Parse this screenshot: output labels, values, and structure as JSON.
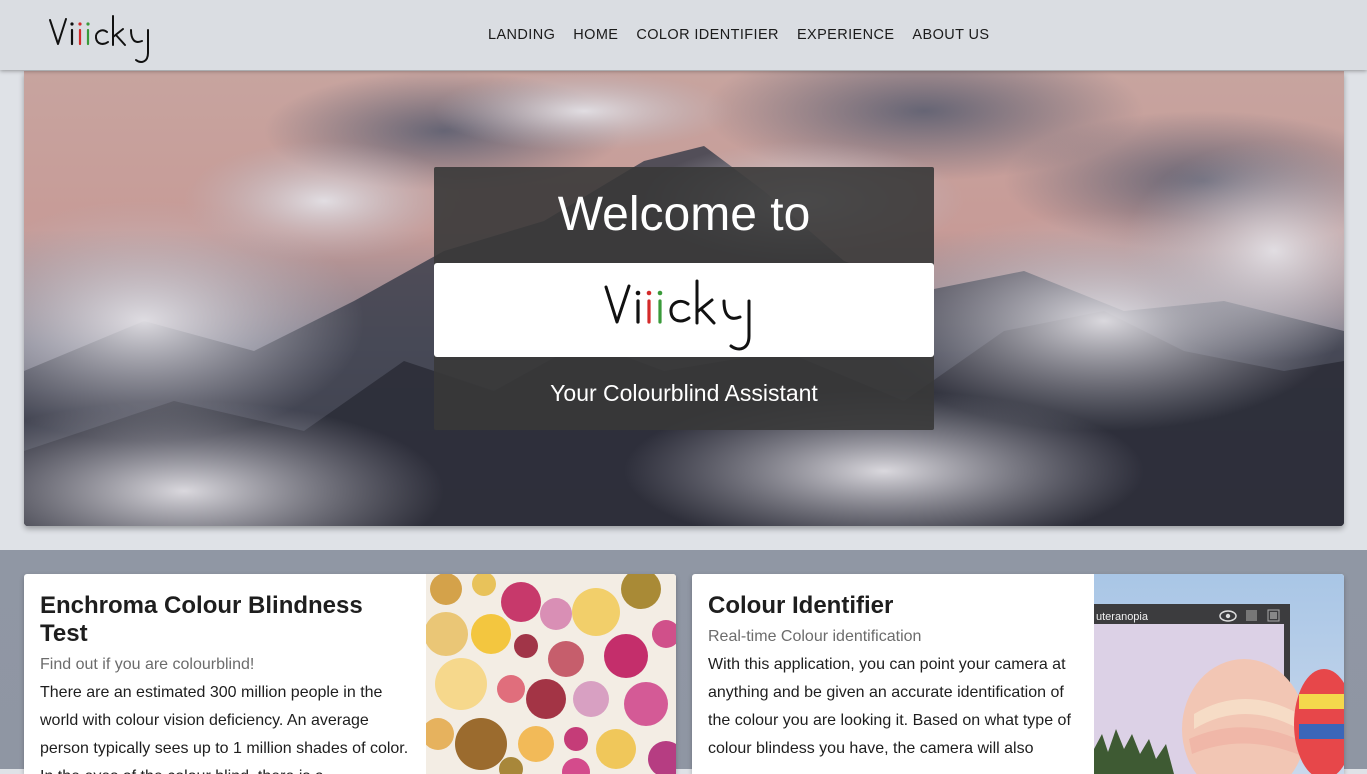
{
  "brand": {
    "name": "Viiicky",
    "letter_colors": [
      "#000000",
      "#d42a2a",
      "#3a9a3a",
      "#2d3fcf",
      "#000000"
    ]
  },
  "nav": {
    "items": [
      {
        "label": "LANDING"
      },
      {
        "label": "HOME"
      },
      {
        "label": "COLOR IDENTIFIER"
      },
      {
        "label": "EXPERIENCE"
      },
      {
        "label": "ABOUT US"
      }
    ]
  },
  "hero": {
    "welcome": "Welcome to",
    "logo_text": "Viiicky",
    "tagline": "Your Colourblind Assistant"
  },
  "cards": [
    {
      "title": "Enchroma Colour Blindness Test",
      "subtitle": "Find out if you are colourblind!",
      "body": "There are an estimated 300 million people in the world with colour vision deficiency. An average person typically sees up to 1 million shades of color. In the eyes of the colour blind, there is a"
    },
    {
      "title": "Colour Identifier",
      "subtitle": "Real-time Colour identification",
      "body": "With this application, you can point your camera at anything and be given an accurate identification of the colour you are looking it. Based on what type of colour blindess you have, the camera will also",
      "image_label": "uteranopia"
    }
  ]
}
